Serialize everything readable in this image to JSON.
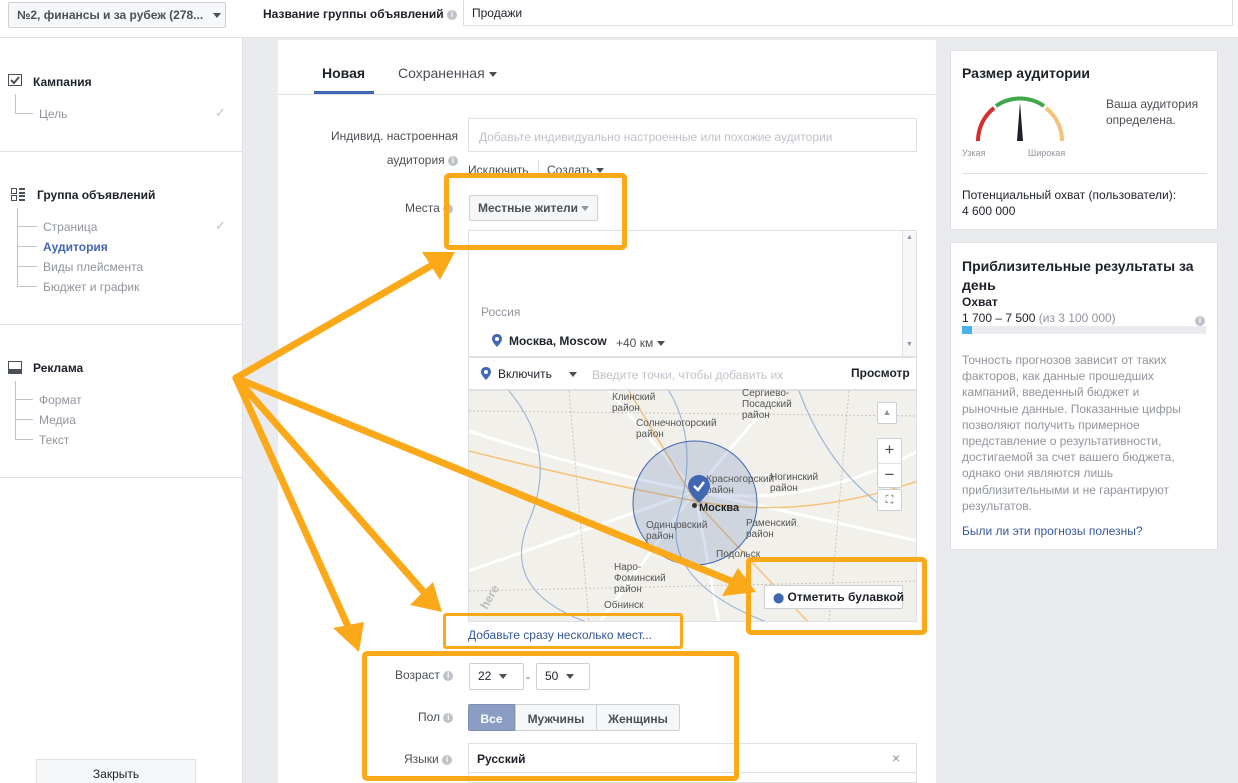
{
  "topbar": {
    "campaign_select": "№2, финансы и за рубеж (278...",
    "adset_name_label": "Название группы объявлений",
    "adset_name_value": "Продажи"
  },
  "sidebar": {
    "campaign": {
      "title": "Кампания",
      "items": [
        "Цель"
      ]
    },
    "adset": {
      "title": "Группа объявлений",
      "items": [
        "Страница",
        "Аудитория",
        "Виды плейсмента",
        "Бюджет и график"
      ]
    },
    "ad": {
      "title": "Реклама",
      "items": [
        "Формат",
        "Медиа",
        "Текст"
      ]
    },
    "close_button": "Закрыть"
  },
  "tabs": {
    "new": "Новая",
    "saved": "Сохраненная"
  },
  "custom_audience": {
    "label_line1": "Индивид. настроенная",
    "label_line2": "аудитория",
    "placeholder": "Добавьте индивидуально настроенные или похожие аудитории",
    "exclude": "Исключить",
    "create": "Создать"
  },
  "places": {
    "label": "Места",
    "dropdown": "Местные жители",
    "country": "Россия",
    "location": "Москва, Moscow",
    "radius": "+40 км",
    "include": "Включить",
    "search_placeholder": "Введите точки, чтобы добавить их",
    "browse": "Просмотр",
    "drop_pin": "Отметить булавкой",
    "add_multiple": "Добавьте сразу несколько мест..."
  },
  "map": {
    "labels": [
      "Клинский район",
      "Солнечногорский район",
      "Сергиево-Посадский район",
      "Красногорский район",
      "Москва",
      "Ногинский район",
      "Одинцовский район",
      "Раменский район",
      "Наро-Фоминский район",
      "Подольск",
      "Обнинск"
    ],
    "brand": "here"
  },
  "age": {
    "label": "Возраст",
    "from": "22",
    "dash": "-",
    "to": "50"
  },
  "gender": {
    "label": "Пол",
    "options": [
      "Все",
      "Мужчины",
      "Женщины"
    ]
  },
  "languages": {
    "label": "Языки",
    "value": "Русский",
    "clear": "×"
  },
  "audience_size": {
    "title": "Размер аудитории",
    "status_line1": "Ваша аудитория",
    "status_line2": "определена.",
    "narrow": "Узкая",
    "wide": "Широкая",
    "reach_label": "Потенциальный охват (пользователи):",
    "reach_value": "4 600 000"
  },
  "daily_results": {
    "title_line1": "Приблизительные результаты за",
    "title_line2": "день",
    "reach_title": "Охват",
    "reach_range": "1 700 – 7 500",
    "reach_of": "(из 3 100 000)",
    "reach_fraction": 0.04,
    "description": [
      "Точность прогнозов зависит от таких",
      "факторов, как данные прошедших",
      "кампаний, введенный бюджет и",
      "рыночные данные. Показанные цифры",
      "позволяют получить примерное",
      "представление о результативности,",
      "достигаемой за счет вашего бюджета,",
      "однако они являются лишь",
      "приблизительными и не гарантируют",
      "результатов."
    ],
    "feedback_link": "Были ли эти прогнозы полезны?"
  },
  "colors": {
    "highlight": "#fba919",
    "accent": "#4267b2",
    "link": "#365899"
  }
}
